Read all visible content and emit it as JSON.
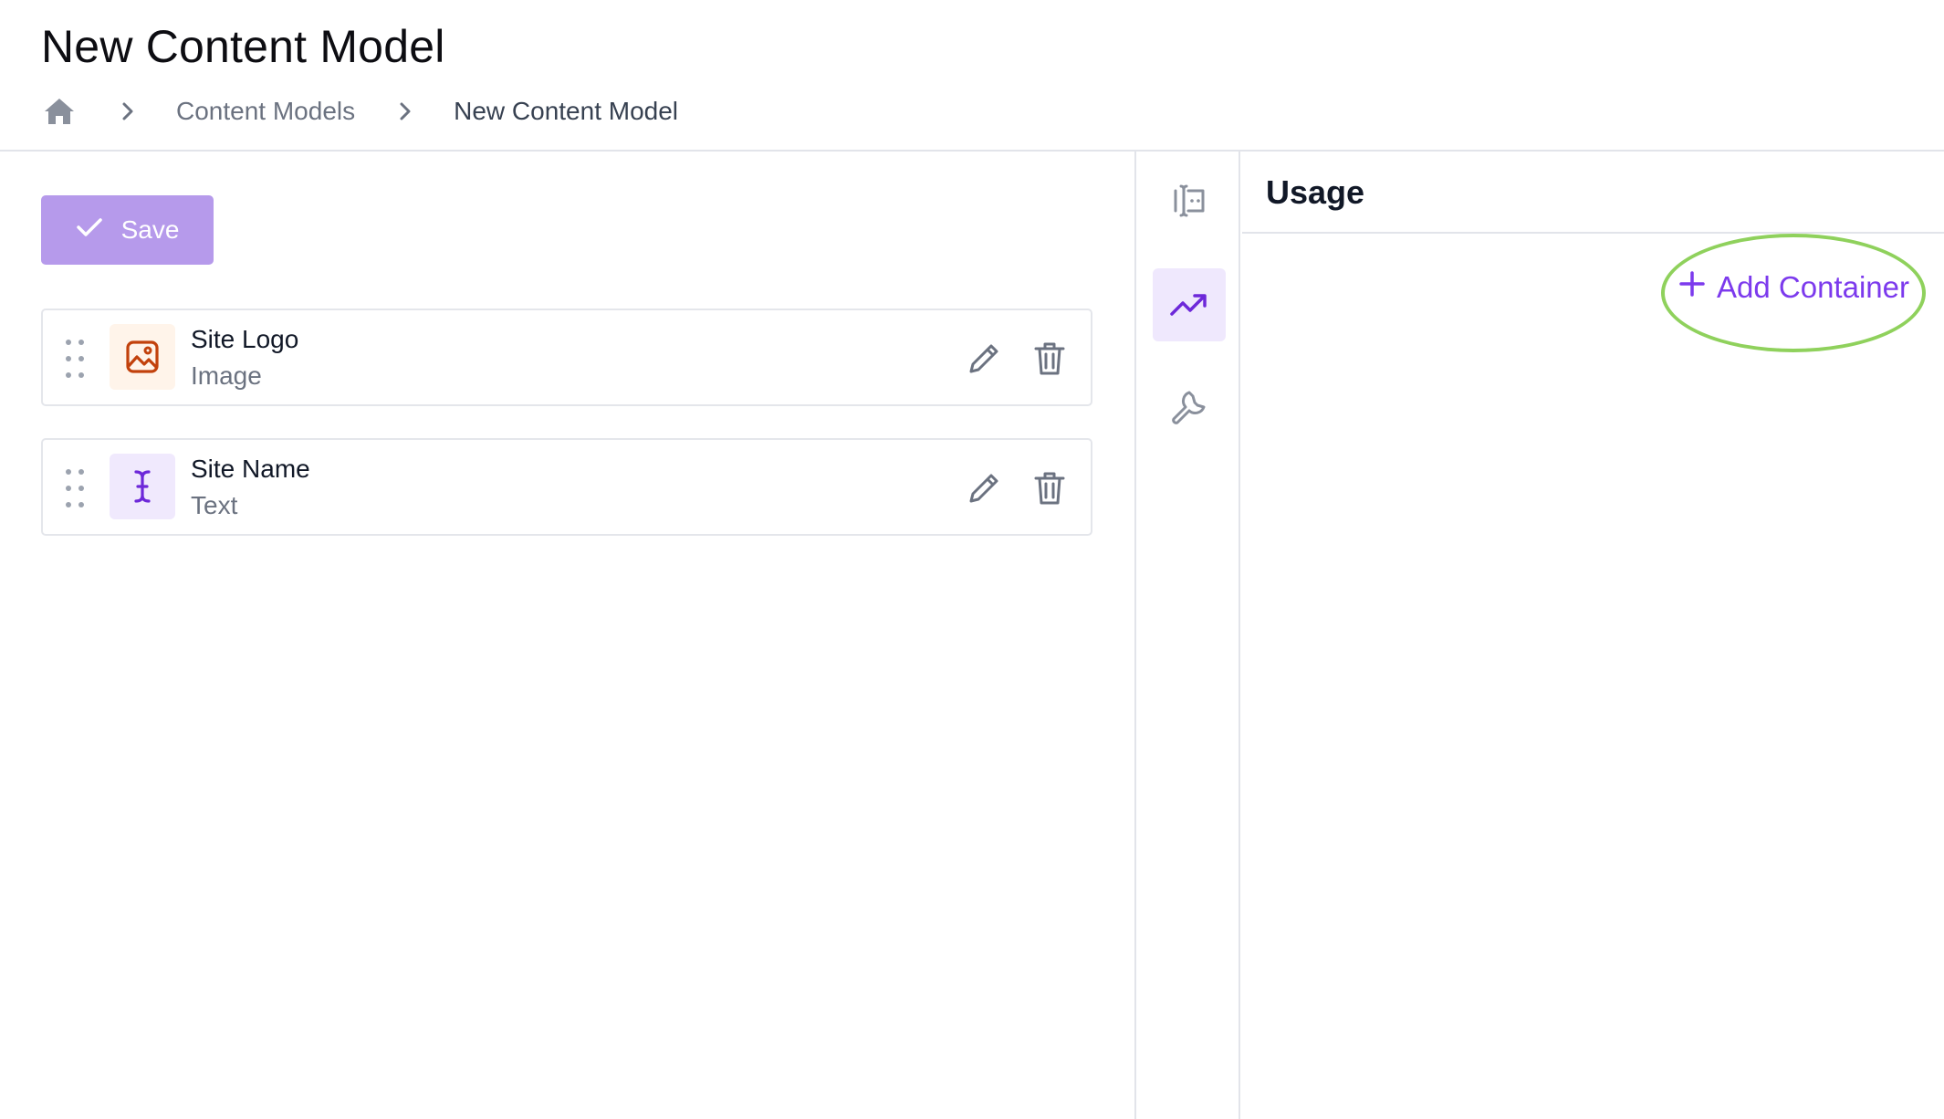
{
  "header": {
    "title": "New Content Model",
    "breadcrumb": {
      "home_icon": "home-icon",
      "items": [
        "Content Models",
        "New Content Model"
      ]
    }
  },
  "toolbar": {
    "save_label": "Save",
    "save_icon": "check-icon"
  },
  "fields": [
    {
      "name": "Site Logo",
      "type": "Image",
      "icon": "image-icon",
      "icon_color": "#c2410c",
      "icon_bg": "#fff4ea"
    },
    {
      "name": "Site Name",
      "type": "Text",
      "icon": "text-cursor-icon",
      "icon_color": "#6d28d9",
      "icon_bg": "#f0e9fd"
    }
  ],
  "rail": {
    "items": [
      {
        "icon": "field-list-icon",
        "active": false
      },
      {
        "icon": "trending-up-icon",
        "active": true
      },
      {
        "icon": "wrench-icon",
        "active": false
      }
    ]
  },
  "panel": {
    "title": "Usage",
    "add_container_label": "Add Container",
    "add_icon": "plus-icon"
  },
  "colors": {
    "accent": "#7c3aed",
    "save_button_bg": "#b69aeb",
    "highlight": "#8fd15c"
  }
}
